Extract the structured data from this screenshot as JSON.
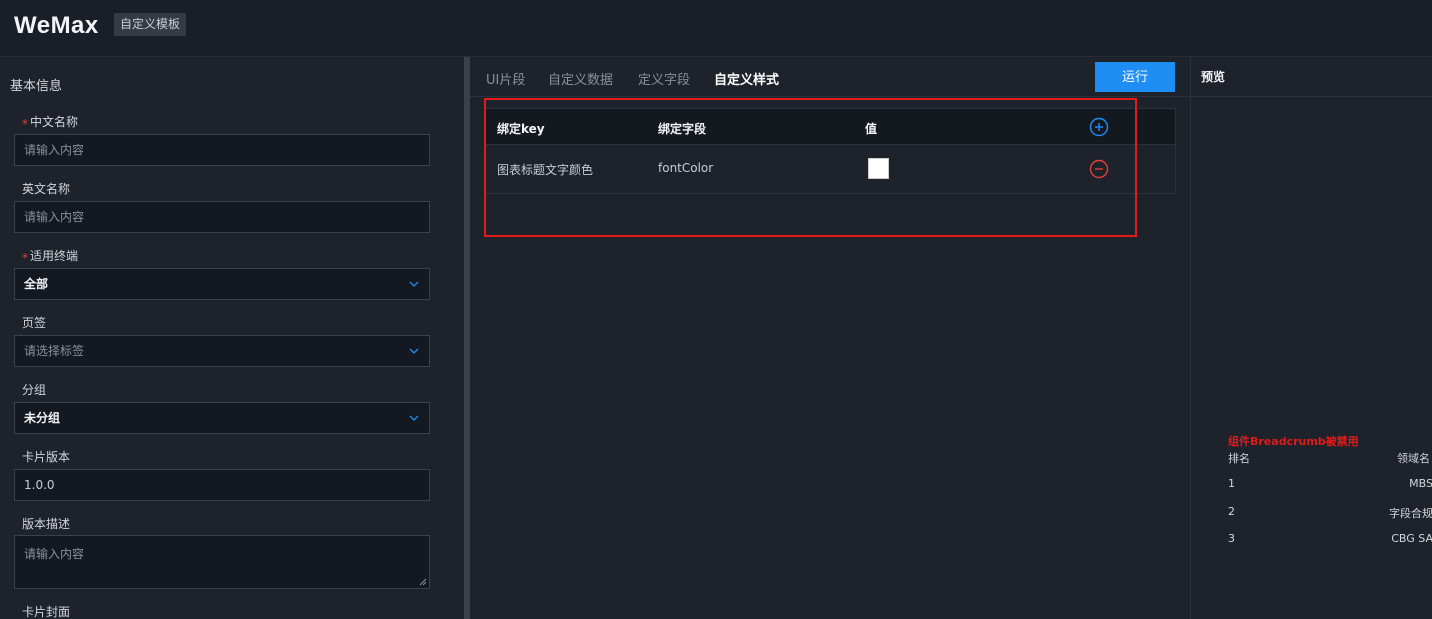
{
  "header": {
    "logo": "WeMax",
    "tag": "自定义模板"
  },
  "form": {
    "section_title": "基本信息",
    "cn_name": {
      "label": "中文名称",
      "placeholder": "请输入内容"
    },
    "en_name": {
      "label": "英文名称",
      "placeholder": "请输入内容"
    },
    "terminal": {
      "label": "适用终端",
      "value": "全部"
    },
    "page_tag": {
      "label": "页签",
      "placeholder": "请选择标签"
    },
    "group": {
      "label": "分组",
      "value": "未分组"
    },
    "version": {
      "label": "卡片版本",
      "value": "1.0.0"
    },
    "desc": {
      "label": "版本描述",
      "placeholder": "请输入内容"
    },
    "cover": {
      "label": "卡片封面"
    }
  },
  "tabs": [
    {
      "label": "UI片段"
    },
    {
      "label": "自定义数据"
    },
    {
      "label": "定义字段"
    },
    {
      "label": "自定义样式",
      "active": true
    }
  ],
  "run_label": "运行",
  "style_table": {
    "headers": [
      "绑定key",
      "绑定字段",
      "值"
    ],
    "rows": [
      {
        "key": "图表标题文字颜色",
        "field": "fontColor",
        "value": "#ffffff"
      }
    ]
  },
  "preview": {
    "title": "预览",
    "error": "组件Breadcrumb被禁用",
    "col_rank": "排名",
    "col_domain": "领域名",
    "rows": [
      {
        "rank": "1",
        "domain": "MBS"
      },
      {
        "rank": "2",
        "domain": "字段合规"
      },
      {
        "rank": "3",
        "domain": "CBG SA"
      }
    ]
  },
  "colors": {
    "accent": "#1e8ef5",
    "highlight": "#e21a1a",
    "danger": "#e0403a"
  }
}
